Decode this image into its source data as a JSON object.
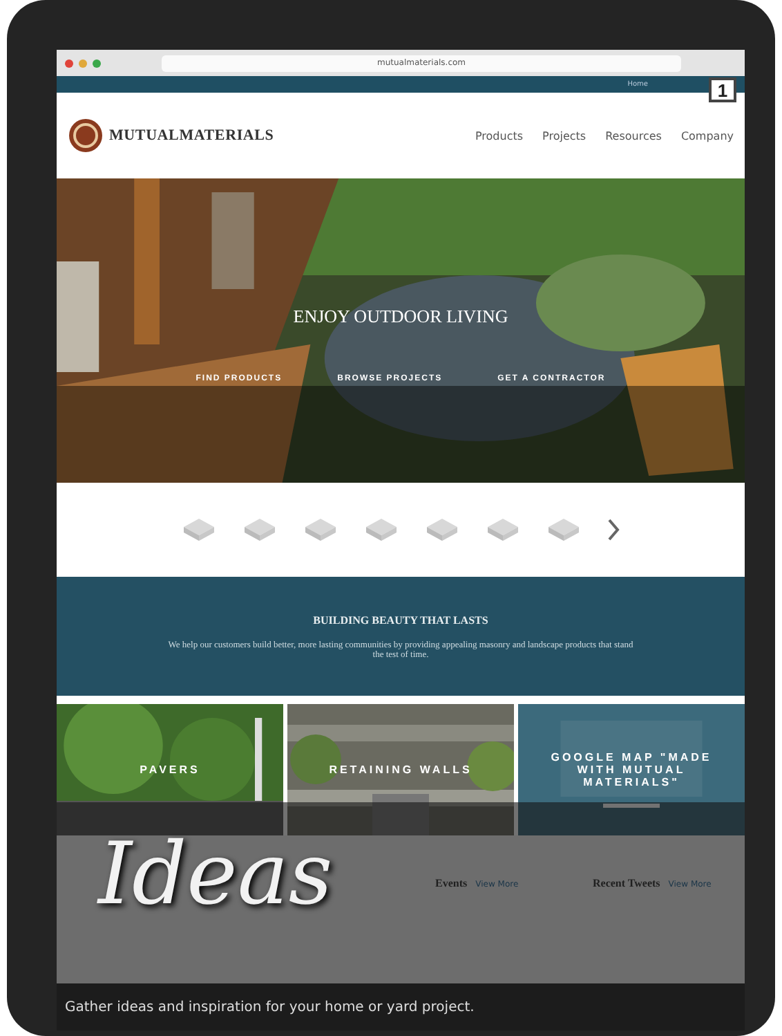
{
  "browser": {
    "url": "mutualmaterials.com"
  },
  "badge": "1",
  "top_links": [
    "Home"
  ],
  "logo": "MUTUALMATERIALS",
  "nav": [
    "Products",
    "Projects",
    "Resources",
    "Company"
  ],
  "hero": {
    "title": "ENJOY OUTDOOR LIVING",
    "actions": [
      "FIND PRODUCTS",
      "BROWSE PROJECTS",
      "GET A CONTRACTOR"
    ]
  },
  "band": {
    "title": "BUILDING BEAUTY THAT LASTS",
    "text": "We help our customers build better, more lasting communities by providing appealing masonry and landscape products that stand the test of time."
  },
  "tiles": [
    {
      "label": "PAVERS",
      "kind": "garden"
    },
    {
      "label": "RETAINING WALLS",
      "kind": "wall"
    },
    {
      "label": "GOOGLE MAP \"MADE WITH MUTUAL MATERIALS\"",
      "kind": "map"
    }
  ],
  "columns": [
    {
      "heading": "Events",
      "link": "View More"
    },
    {
      "heading": "Recent Tweets",
      "link": "View More"
    }
  ],
  "overlay": {
    "title": "Ideas",
    "caption": "Gather ideas and inspiration for your home or yard project."
  }
}
